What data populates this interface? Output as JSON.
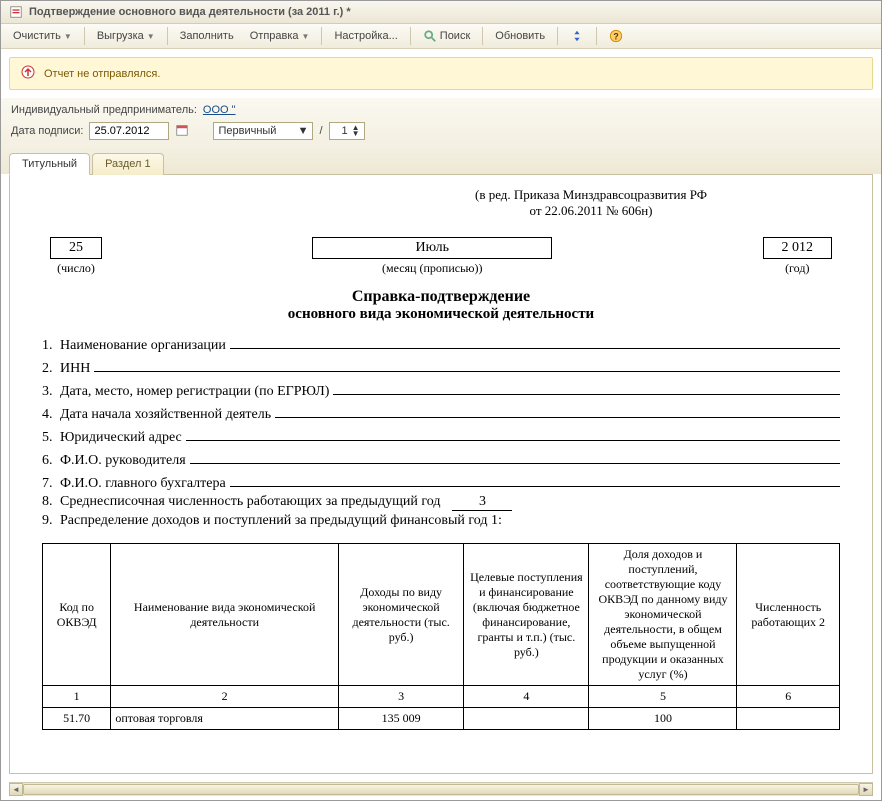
{
  "window": {
    "title": "Подтверждение основного вида деятельности  (за 2011 г.) *"
  },
  "toolbar": {
    "clear": "Очистить",
    "export": "Выгрузка",
    "fill": "Заполнить",
    "send": "Отправка",
    "settings": "Настройка...",
    "search": "Поиск",
    "refresh": "Обновить"
  },
  "status": {
    "text": "Отчет не отправлялся."
  },
  "form": {
    "ip_label": "Индивидуальный предприниматель:",
    "ip_value": "ООО \"",
    "sign_date_label": "Дата подписи:",
    "sign_date": "25.07.2012",
    "type": "Первичный",
    "copy_num": "1"
  },
  "tabs": {
    "t1": "Титульный",
    "t2": "Раздел 1"
  },
  "doc": {
    "meta1": "(в ред. Приказа Минздравсоцразвития РФ",
    "meta2": "от 22.06.2011 № 606н)",
    "day": "25",
    "month": "Июль",
    "year": "2 012",
    "day_lbl": "(число)",
    "month_lbl": "(месяц (прописью))",
    "year_lbl": "(год)",
    "title1": "Справка-подтверждение",
    "title2": "основного вида экономической деятельности",
    "lines": {
      "l1": "Наименование организации",
      "l1v": "",
      "l2": "ИНН",
      "l2v": "",
      "l3": "Дата, место, номер регистрации (по ЕГРЮЛ)",
      "l3v": "",
      "l4": "Дата начала хозяйственной деятель",
      "l4v": "",
      "l5": "Юридический адрес",
      "l5v": "",
      "l6": "Ф.И.О. руководителя",
      "l6v": "",
      "l7": "Ф.И.О. главного бухгалтера",
      "l7v": "",
      "l8": "Среднесписочная численность работающих за предыдущий год",
      "l8v": "3",
      "l9": "Распределение доходов и поступлений за предыдущий финансовый год 1:"
    },
    "table": {
      "h1": "Код по ОКВЭД",
      "h2": "Наименование вида экономической деятельности",
      "h3": "Доходы по виду экономической деятельности (тыс. руб.)",
      "h4": "Целевые поступления и финансирование (включая бюджетное финансирование, гранты и т.п.) (тыс. руб.)",
      "h5": "Доля доходов и поступлений, соответствующие коду ОКВЭД по данному виду экономической деятельности, в общем объеме выпущенной продукции и оказанных услуг (%)",
      "h6": "Численность работающих 2",
      "n1": "1",
      "n2": "2",
      "n3": "3",
      "n4": "4",
      "n5": "5",
      "n6": "6",
      "r1c1": "51.70",
      "r1c2": "оптовая торговля",
      "r1c3": "135 009",
      "r1c4": "",
      "r1c5": "100",
      "r1c6": ""
    }
  }
}
